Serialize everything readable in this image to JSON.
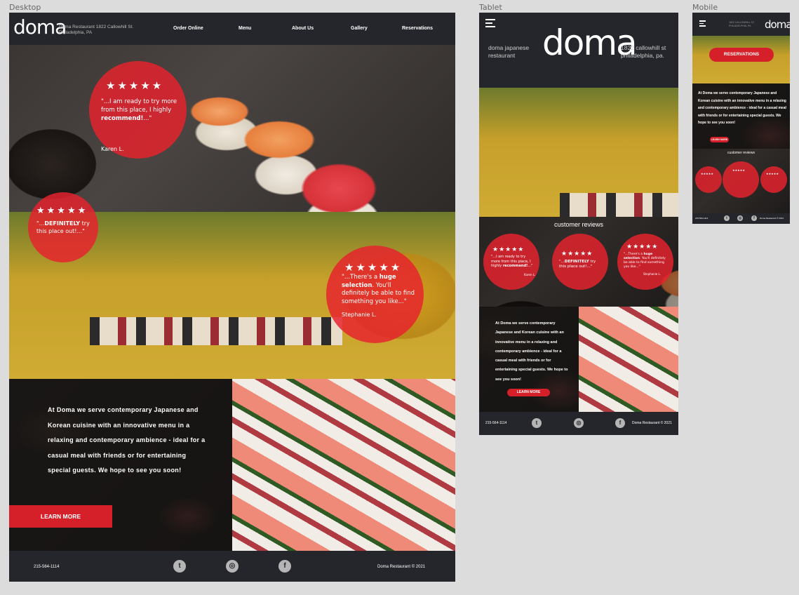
{
  "frames": {
    "desktop": "Desktop",
    "tablet": "Tablet",
    "mobile": "Mobile"
  },
  "brand": {
    "logo_text": "doma",
    "name_tablet": "doma japanese restaurant",
    "address_desktop": "Doma Restaurant 1822 Callowhill St. Philadelphia, PA",
    "address_tablet": "1822 callowhill st philadelphia, pa.",
    "address_mobile": "1822 CALLOWHILL ST PHILADELPHIA, PA",
    "accent_color": "#d52029",
    "dark_color": "#25262b"
  },
  "nav": [
    "Order Online",
    "Menu",
    "About Us",
    "Gallery",
    "Reservations"
  ],
  "reviews": [
    {
      "stars": "★★★★★",
      "pre": "\"...I am ready to try more from this place, I highly ",
      "bold": "recommend!",
      "post": "...\"",
      "author": "Karen L."
    },
    {
      "stars": "★★★★★",
      "pre": "\"...",
      "bold": "DEFINITELY",
      "post": " try this place out!...\"",
      "author": ""
    },
    {
      "stars": "★★★★★",
      "pre": "\"...There's a ",
      "bold": "huge selection",
      "post": ". You'll definitely be able to find something you like...\"",
      "author": "Stephanie L."
    }
  ],
  "about": {
    "text": "At Doma we serve contemporary Japanese and Korean cuisine with an innovative menu in a relaxing and contemporary ambience - ideal for a casual meal with friends or for entertaining special guests. We hope to see you soon!",
    "button": "LEARN MORE"
  },
  "reviews_title": "customer reviews",
  "reservations_button": "RESERVATIONS",
  "footer": {
    "phone": "215-564-1114",
    "copyright": "Doma Restaurant © 2021"
  },
  "icons": {
    "twitter": "twitter-icon",
    "instagram": "instagram-icon",
    "facebook": "facebook-icon",
    "menu": "hamburger-menu-icon"
  }
}
